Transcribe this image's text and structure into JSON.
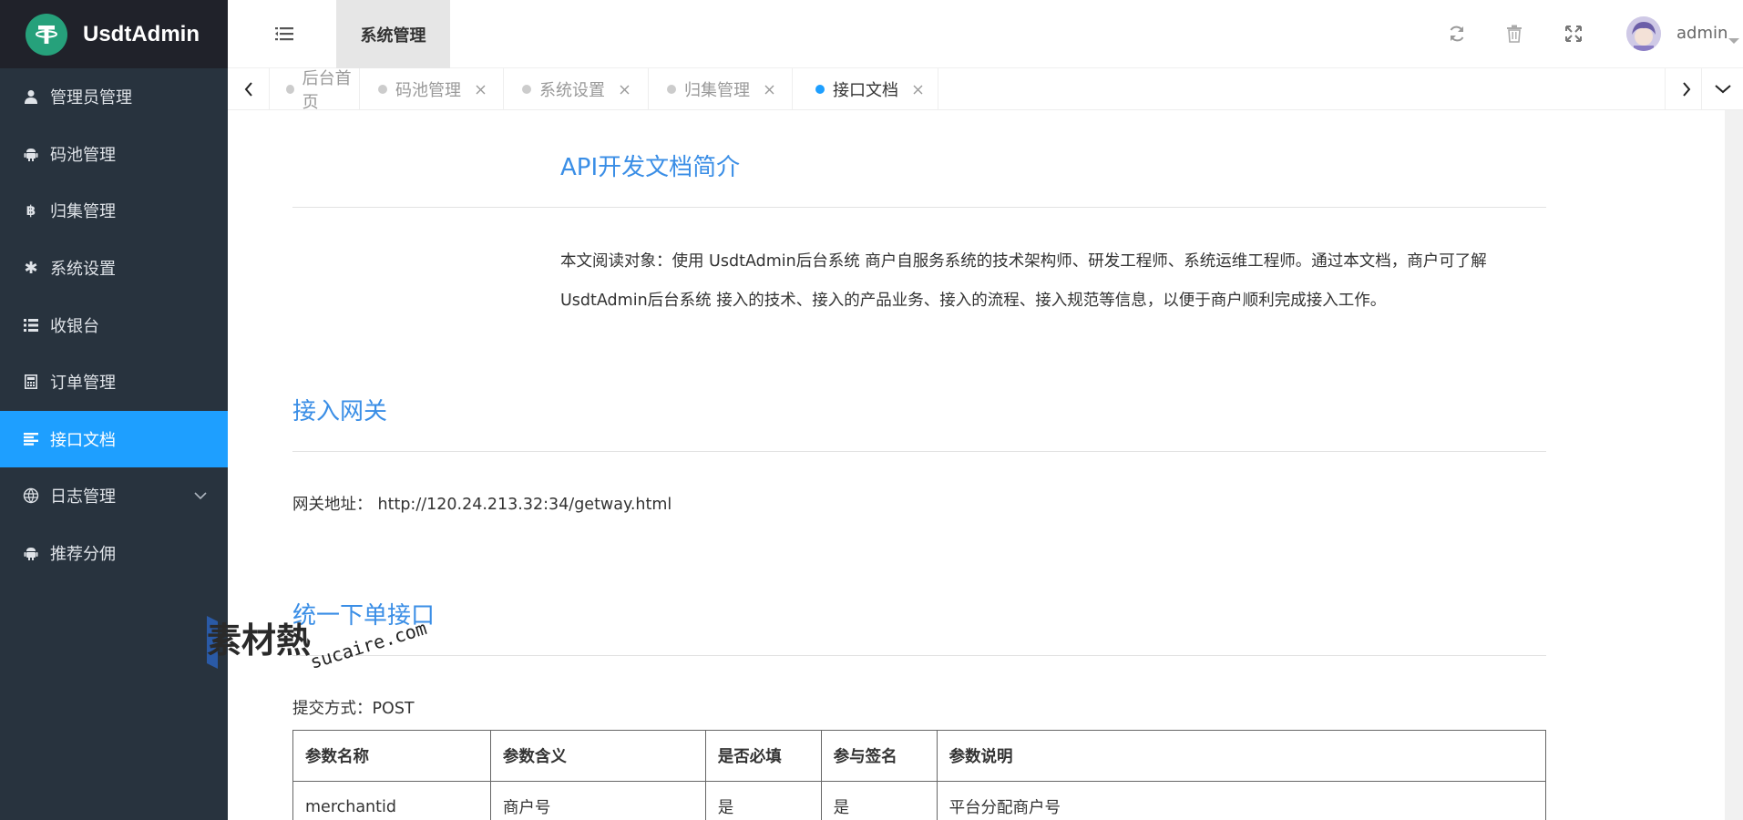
{
  "app": {
    "title": "UsdtAdmin"
  },
  "sidebar": {
    "items": [
      {
        "label": "管理员管理",
        "icon": "user-icon"
      },
      {
        "label": "码池管理",
        "icon": "android-icon"
      },
      {
        "label": "归集管理",
        "icon": "bitcoin-icon"
      },
      {
        "label": "系统设置",
        "icon": "asterisk-icon"
      },
      {
        "label": "收银台",
        "icon": "list-icon"
      },
      {
        "label": "订单管理",
        "icon": "calculator-icon"
      },
      {
        "label": "接口文档",
        "icon": "align-left-icon",
        "active": true
      },
      {
        "label": "日志管理",
        "icon": "globe-icon",
        "has_children": true
      },
      {
        "label": "推荐分佣",
        "icon": "android-icon"
      }
    ]
  },
  "header": {
    "section_tab": "系统管理",
    "username": "admin",
    "icons": [
      "refresh-icon",
      "trash-icon",
      "expand-icon"
    ]
  },
  "tabs": [
    {
      "label": "后台首页",
      "closable": false
    },
    {
      "label": "码池管理",
      "closable": true
    },
    {
      "label": "系统设置",
      "closable": true
    },
    {
      "label": "归集管理",
      "closable": true
    },
    {
      "label": "接口文档",
      "closable": true,
      "active": true
    }
  ],
  "doc": {
    "intro_title": "API开发文档简介",
    "intro_line1": "本文阅读对象：使用 UsdtAdmin后台系统 商户自服务系统的技术架构师、研发工程师、系统运维工程师。通过本文档，商户可了解",
    "intro_line2": "UsdtAdmin后台系统 接入的技术、接入的产品业务、接入的流程、接入规范等信息，以便于商户顺利完成接入工作。",
    "gateway_title": "接入网关",
    "gateway_label": "网关地址：",
    "gateway_url": "http://120.24.213.32:34/getway.html",
    "order_title": "统一下单接口",
    "submit_label": "提交方式：POST",
    "table": {
      "headers": [
        "参数名称",
        "参数含义",
        "是否必填",
        "参与签名",
        "参数说明"
      ],
      "rows": [
        [
          "merchantid",
          "商户号",
          "是",
          "是",
          "平台分配商户号"
        ]
      ]
    }
  },
  "watermark": {
    "cn": "素材熱",
    "en": "sucaire.com"
  },
  "colors": {
    "sidebar_bg": "#28333e",
    "logo_bg": "#20222a",
    "accent": "#1e9fff",
    "title_blue": "#3a8ee6",
    "tether_green": "#26a17b"
  }
}
